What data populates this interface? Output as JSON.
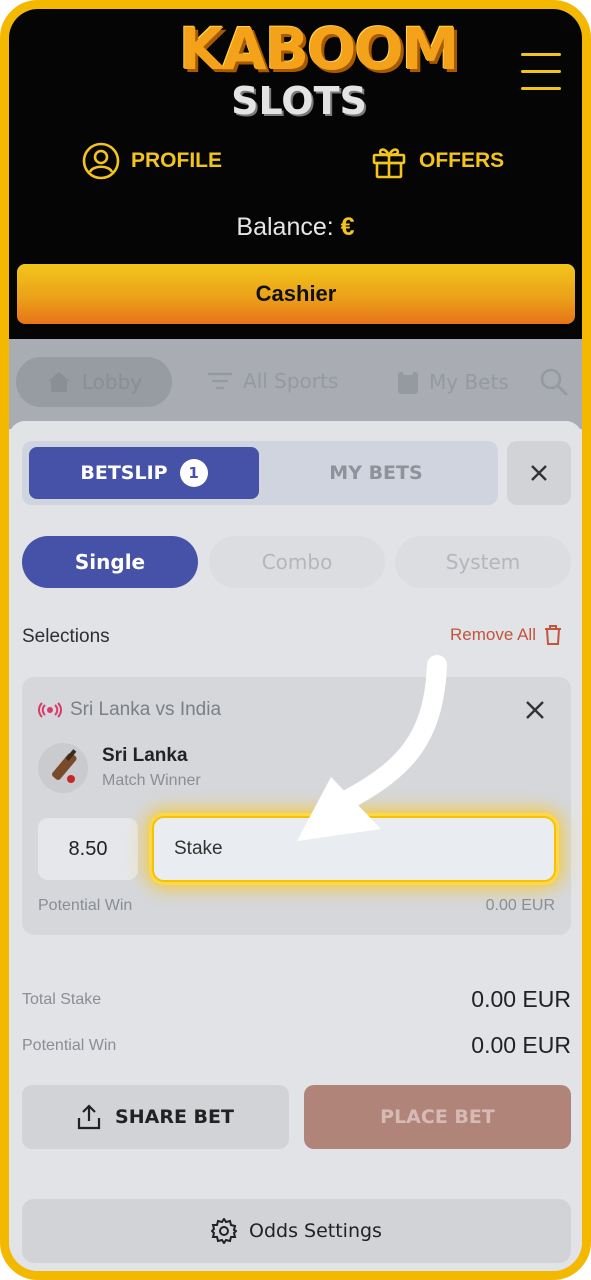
{
  "header": {
    "logo_top": "KABOOM",
    "logo_bottom": "SLOTS",
    "profile_label": "PROFILE",
    "offers_label": "OFFERS",
    "balance_label": "Balance:",
    "balance_currency": "€",
    "cashier_label": "Cashier",
    "accent_color": "#f3c41d"
  },
  "nav": {
    "lobby": "Lobby",
    "all_sports": "All Sports",
    "my_bets": "My Bets"
  },
  "betslip": {
    "tab_betslip": "BETSLIP",
    "tab_count": "1",
    "tab_mybets": "MY BETS",
    "types": [
      "Single",
      "Combo",
      "System"
    ],
    "selections_title": "Selections",
    "remove_all": "Remove All",
    "selection": {
      "match": "Sri Lanka vs India",
      "team": "Sri Lanka",
      "market": "Match Winner",
      "odds": "8.50",
      "stake_placeholder": "Stake",
      "potential_win_label": "Potential Win",
      "potential_win_value": "0.00 EUR"
    },
    "total_stake_label": "Total Stake",
    "total_stake_value": "0.00 EUR",
    "potential_win_label": "Potential Win",
    "potential_win_value": "0.00 EUR",
    "share_bet": "SHARE BET",
    "place_bet": "PLACE BET",
    "odds_settings": "Odds Settings",
    "primary_color": "#4652a8"
  }
}
